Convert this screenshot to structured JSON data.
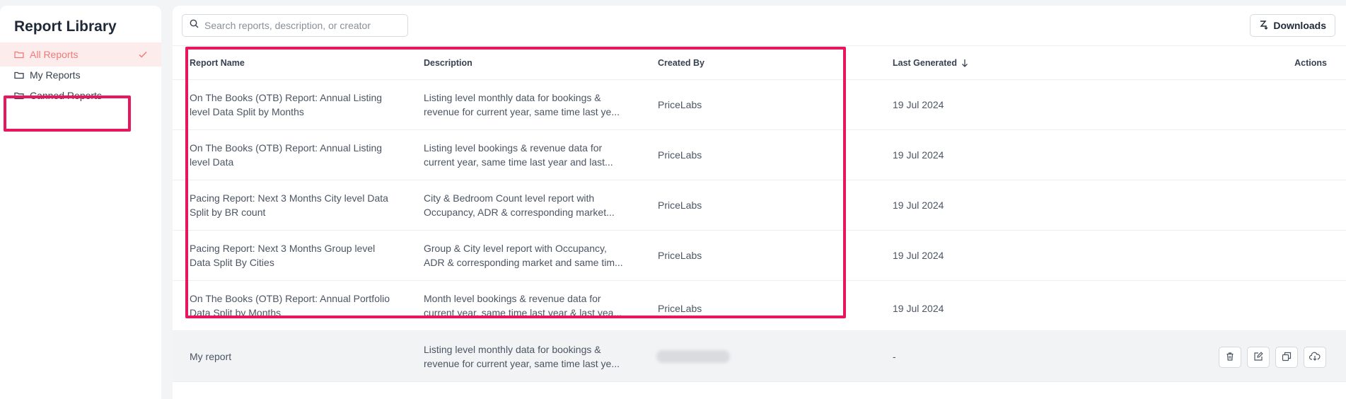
{
  "sidebar": {
    "title": "Report Library",
    "items": [
      {
        "label": "All Reports",
        "active": true
      },
      {
        "label": "My Reports",
        "active": false
      },
      {
        "label": "Canned Reports",
        "active": false
      }
    ]
  },
  "search": {
    "placeholder": "Search reports, description, or creator",
    "value": ""
  },
  "downloads_label": "Downloads",
  "table": {
    "headers": {
      "name": "Report Name",
      "description": "Description",
      "created_by": "Created By",
      "last_generated": "Last Generated",
      "actions": "Actions"
    },
    "sort_column": "Last Generated",
    "sort_direction": "descending",
    "rows": [
      {
        "name": "On The Books (OTB) Report: Annual Listing level Data Split by Months",
        "desc1": "Listing level monthly data for bookings &",
        "desc2": "revenue for current year, same time last ye...",
        "created_by": "PriceLabs",
        "date": "19 Jul 2024"
      },
      {
        "name": "On The Books (OTB) Report: Annual Listing level Data",
        "desc1": "Listing level bookings & revenue data for",
        "desc2": "current year, same time last year and last...",
        "created_by": "PriceLabs",
        "date": "19 Jul 2024"
      },
      {
        "name": "Pacing Report: Next 3 Months City level Data Split by BR count",
        "desc1": "City & Bedroom Count level report with",
        "desc2": "Occupancy, ADR & corresponding market...",
        "created_by": "PriceLabs",
        "date": "19 Jul 2024"
      },
      {
        "name": "Pacing Report: Next 3 Months Group level Data Split By Cities",
        "desc1": "Group & City level report with Occupancy,",
        "desc2": "ADR & corresponding market and same tim...",
        "created_by": "PriceLabs",
        "date": "19 Jul 2024"
      },
      {
        "name": "On The Books (OTB) Report: Annual Portfolio Data Split by Months",
        "desc1": "Month level bookings & revenue data for",
        "desc2": "current year, same time last year & last yea...",
        "created_by": "PriceLabs",
        "date": "19 Jul 2024"
      },
      {
        "name": "My report",
        "desc1": "Listing level monthly data for bookings &",
        "desc2": "revenue for current year, same time last ye...",
        "created_by": "",
        "date": "-"
      }
    ]
  },
  "colors": {
    "active": "#f07a7a",
    "active_bg": "#fdecec",
    "highlight": "#e8175d"
  },
  "icons": [
    "folder-icon",
    "check-icon",
    "search-icon",
    "download-icon",
    "sort-down-icon",
    "trash-icon",
    "edit-icon",
    "copy-icon",
    "cloud-download-icon"
  ]
}
